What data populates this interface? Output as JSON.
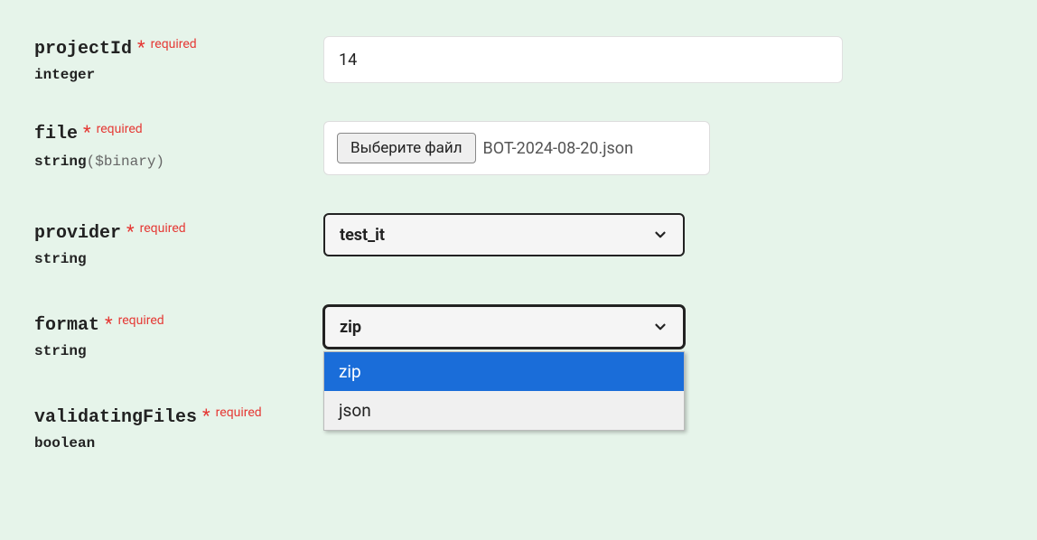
{
  "labels": {
    "required": "required"
  },
  "params": {
    "projectId": {
      "name": "projectId",
      "type": "integer",
      "value": "14"
    },
    "file": {
      "name": "file",
      "type": "string",
      "typeSub": "($binary)",
      "buttonLabel": "Выберите файл",
      "fileName": "BOT-2024-08-20.json"
    },
    "provider": {
      "name": "provider",
      "type": "string",
      "value": "test_it"
    },
    "format": {
      "name": "format",
      "type": "string",
      "value": "zip",
      "options": [
        "zip",
        "json"
      ]
    },
    "validatingFiles": {
      "name": "validatingFiles",
      "type": "boolean",
      "value": "false"
    }
  }
}
